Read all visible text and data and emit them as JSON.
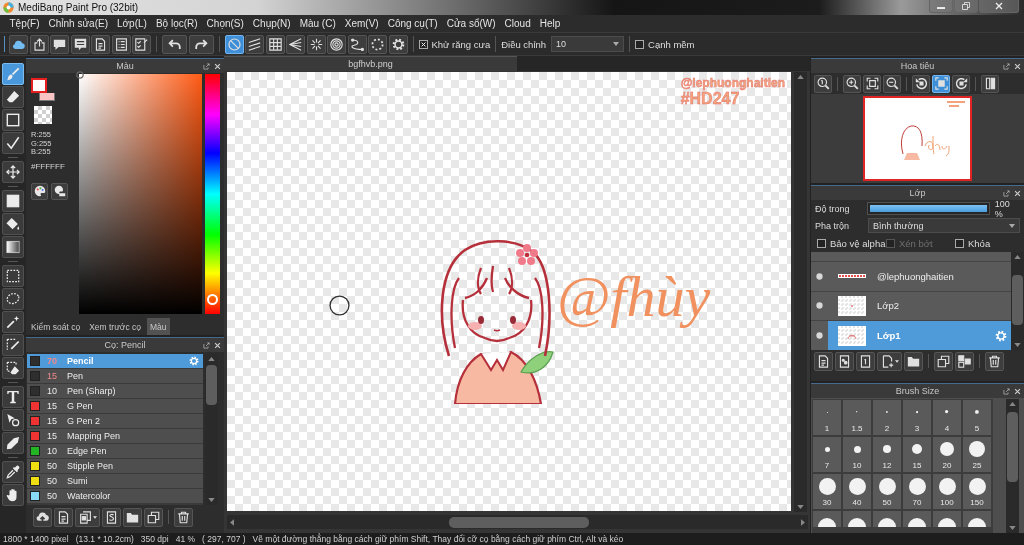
{
  "window": {
    "title": "MediBang Paint Pro (32bit)"
  },
  "menu": [
    "Tệp(F)",
    "Chỉnh sửa(E)",
    "Lớp(L)",
    "Bộ lọc(R)",
    "Chọn(S)",
    "Chụp(N)",
    "Màu (C)",
    "Xem(V)",
    "Công cụ(T)",
    "Cửa sổ(W)",
    "Cloud",
    "Help"
  ],
  "toolbar": {
    "guides": [
      {
        "selected": true
      },
      {
        "selected": false
      },
      {
        "selected": false
      },
      {
        "selected": false
      },
      {
        "selected": false
      },
      {
        "selected": false
      },
      {
        "selected": false
      },
      {
        "selected": false
      },
      {
        "selected": false
      }
    ],
    "antialias": {
      "label": "Khử răng cưa",
      "checked": true
    },
    "correction": {
      "label": "Điều chỉnh",
      "value": "10"
    },
    "soft_edge": {
      "label": "Cạnh mềm",
      "checked": false
    }
  },
  "tools": [
    {
      "selected": true
    },
    {
      "selected": false
    },
    {
      "selected": false
    },
    {
      "selected": false
    },
    {
      "selected": false
    },
    {
      "selected": false
    },
    {
      "selected": false
    },
    {
      "selected": false
    },
    {
      "selected": false
    },
    {
      "selected": false
    },
    {
      "selected": false
    },
    {
      "selected": false
    },
    {
      "selected": false
    },
    {
      "selected": false
    },
    {
      "selected": false
    },
    {
      "selected": false
    },
    {
      "selected": false
    },
    {
      "selected": false
    }
  ],
  "color_panel": {
    "title": "Màu",
    "swatches": [
      {
        "color": "#ffffff",
        "selected": true
      },
      {
        "color": "#f9c4c4",
        "selected": false
      }
    ],
    "rgb": [
      "R:255",
      "G:255",
      "B:255"
    ],
    "hex": "#FFFFFF",
    "hue_slider": {
      "level": 0.03
    },
    "tabs": [
      {
        "label": "Kiểm soát cọ",
        "selected": false
      },
      {
        "label": "Xem trước cọ",
        "selected": false
      },
      {
        "label": "Màu",
        "selected": true
      }
    ]
  },
  "brush_panel": {
    "title": "Cọ: Pencil",
    "brushes": [
      {
        "color": "#2e2e2e",
        "size": "70",
        "name": "Pencil",
        "selected": true,
        "size_highlighted": true
      },
      {
        "color": "#2e2e2e",
        "size": "15",
        "name": "Pen",
        "selected": false,
        "size_highlighted": true
      },
      {
        "color": "#2e2e2e",
        "size": "10",
        "name": "Pen (Sharp)",
        "selected": false,
        "size_highlighted": false
      },
      {
        "color": "#ee3333",
        "size": "15",
        "name": "G Pen",
        "selected": false,
        "size_highlighted": false
      },
      {
        "color": "#ee3333",
        "size": "15",
        "name": "G Pen 2",
        "selected": false,
        "size_highlighted": false
      },
      {
        "color": "#ee3333",
        "size": "15",
        "name": "Mapping Pen",
        "selected": false,
        "size_highlighted": false
      },
      {
        "color": "#22b422",
        "size": "10",
        "name": "Edge Pen",
        "selected": false,
        "size_highlighted": false
      },
      {
        "color": "#eedd11",
        "size": "50",
        "name": "Stipple Pen",
        "selected": false,
        "size_highlighted": false
      },
      {
        "color": "#eedd11",
        "size": "50",
        "name": "Sumi",
        "selected": false,
        "size_highlighted": false
      },
      {
        "color": "#88d8f8",
        "size": "50",
        "name": "Watercolor",
        "selected": false,
        "size_highlighted": false
      }
    ]
  },
  "canvas": {
    "tab": "bgfhvb.png",
    "tag_lines": [
      "@lephuonghaitien",
      "#HD247"
    ],
    "signature": "@fhùy"
  },
  "navigator": {
    "title": "Hoa tiêu",
    "tools": [
      {
        "selected": false
      },
      {
        "selected": false
      },
      {
        "selected": false
      },
      {
        "selected": false
      },
      {
        "selected": false
      },
      {
        "selected": true
      },
      {
        "selected": false
      },
      {
        "selected": false
      }
    ]
  },
  "layer_panel": {
    "title": "Lớp",
    "opacity": {
      "label": "Độ trong",
      "level": 1,
      "reading": "100 %"
    },
    "blend": {
      "label": "Pha trộn",
      "value": "Bình thường"
    },
    "options": [
      {
        "label": "Bảo vệ alpha",
        "checked": false,
        "disabled": false
      },
      {
        "label": "Xén bớt",
        "checked": false,
        "disabled": true
      },
      {
        "label": "Khóa",
        "checked": false,
        "disabled": false
      }
    ],
    "layers": [
      {
        "name": "@lephuonghaitien",
        "kind": "text",
        "visible": true,
        "selected": false
      },
      {
        "name": "Lớp2",
        "kind": "raster",
        "visible": true,
        "selected": false
      },
      {
        "name": "Lớp1",
        "kind": "raster",
        "visible": true,
        "selected": true
      }
    ]
  },
  "brush_size_panel": {
    "title": "Brush Size",
    "sizes": [
      "1",
      "1.5",
      "2",
      "3",
      "4",
      "5",
      "7",
      "10",
      "12",
      "15",
      "20",
      "25",
      "30",
      "40",
      "50",
      "70",
      "100",
      "150"
    ]
  },
  "status_bar": {
    "dimensions": "1800 * 1400 pixel",
    "physical_size": "(13.1 * 10.2cm)",
    "resolution": "350 dpi",
    "zoom": "41 %",
    "cursor_position": "( 297, 707 )",
    "hint": "Vẽ một đường thẳng bằng cách giữ phím Shift, Thay đổi cỡ cọ bằng cách giữ phím Ctrl, Alt và kéo"
  }
}
